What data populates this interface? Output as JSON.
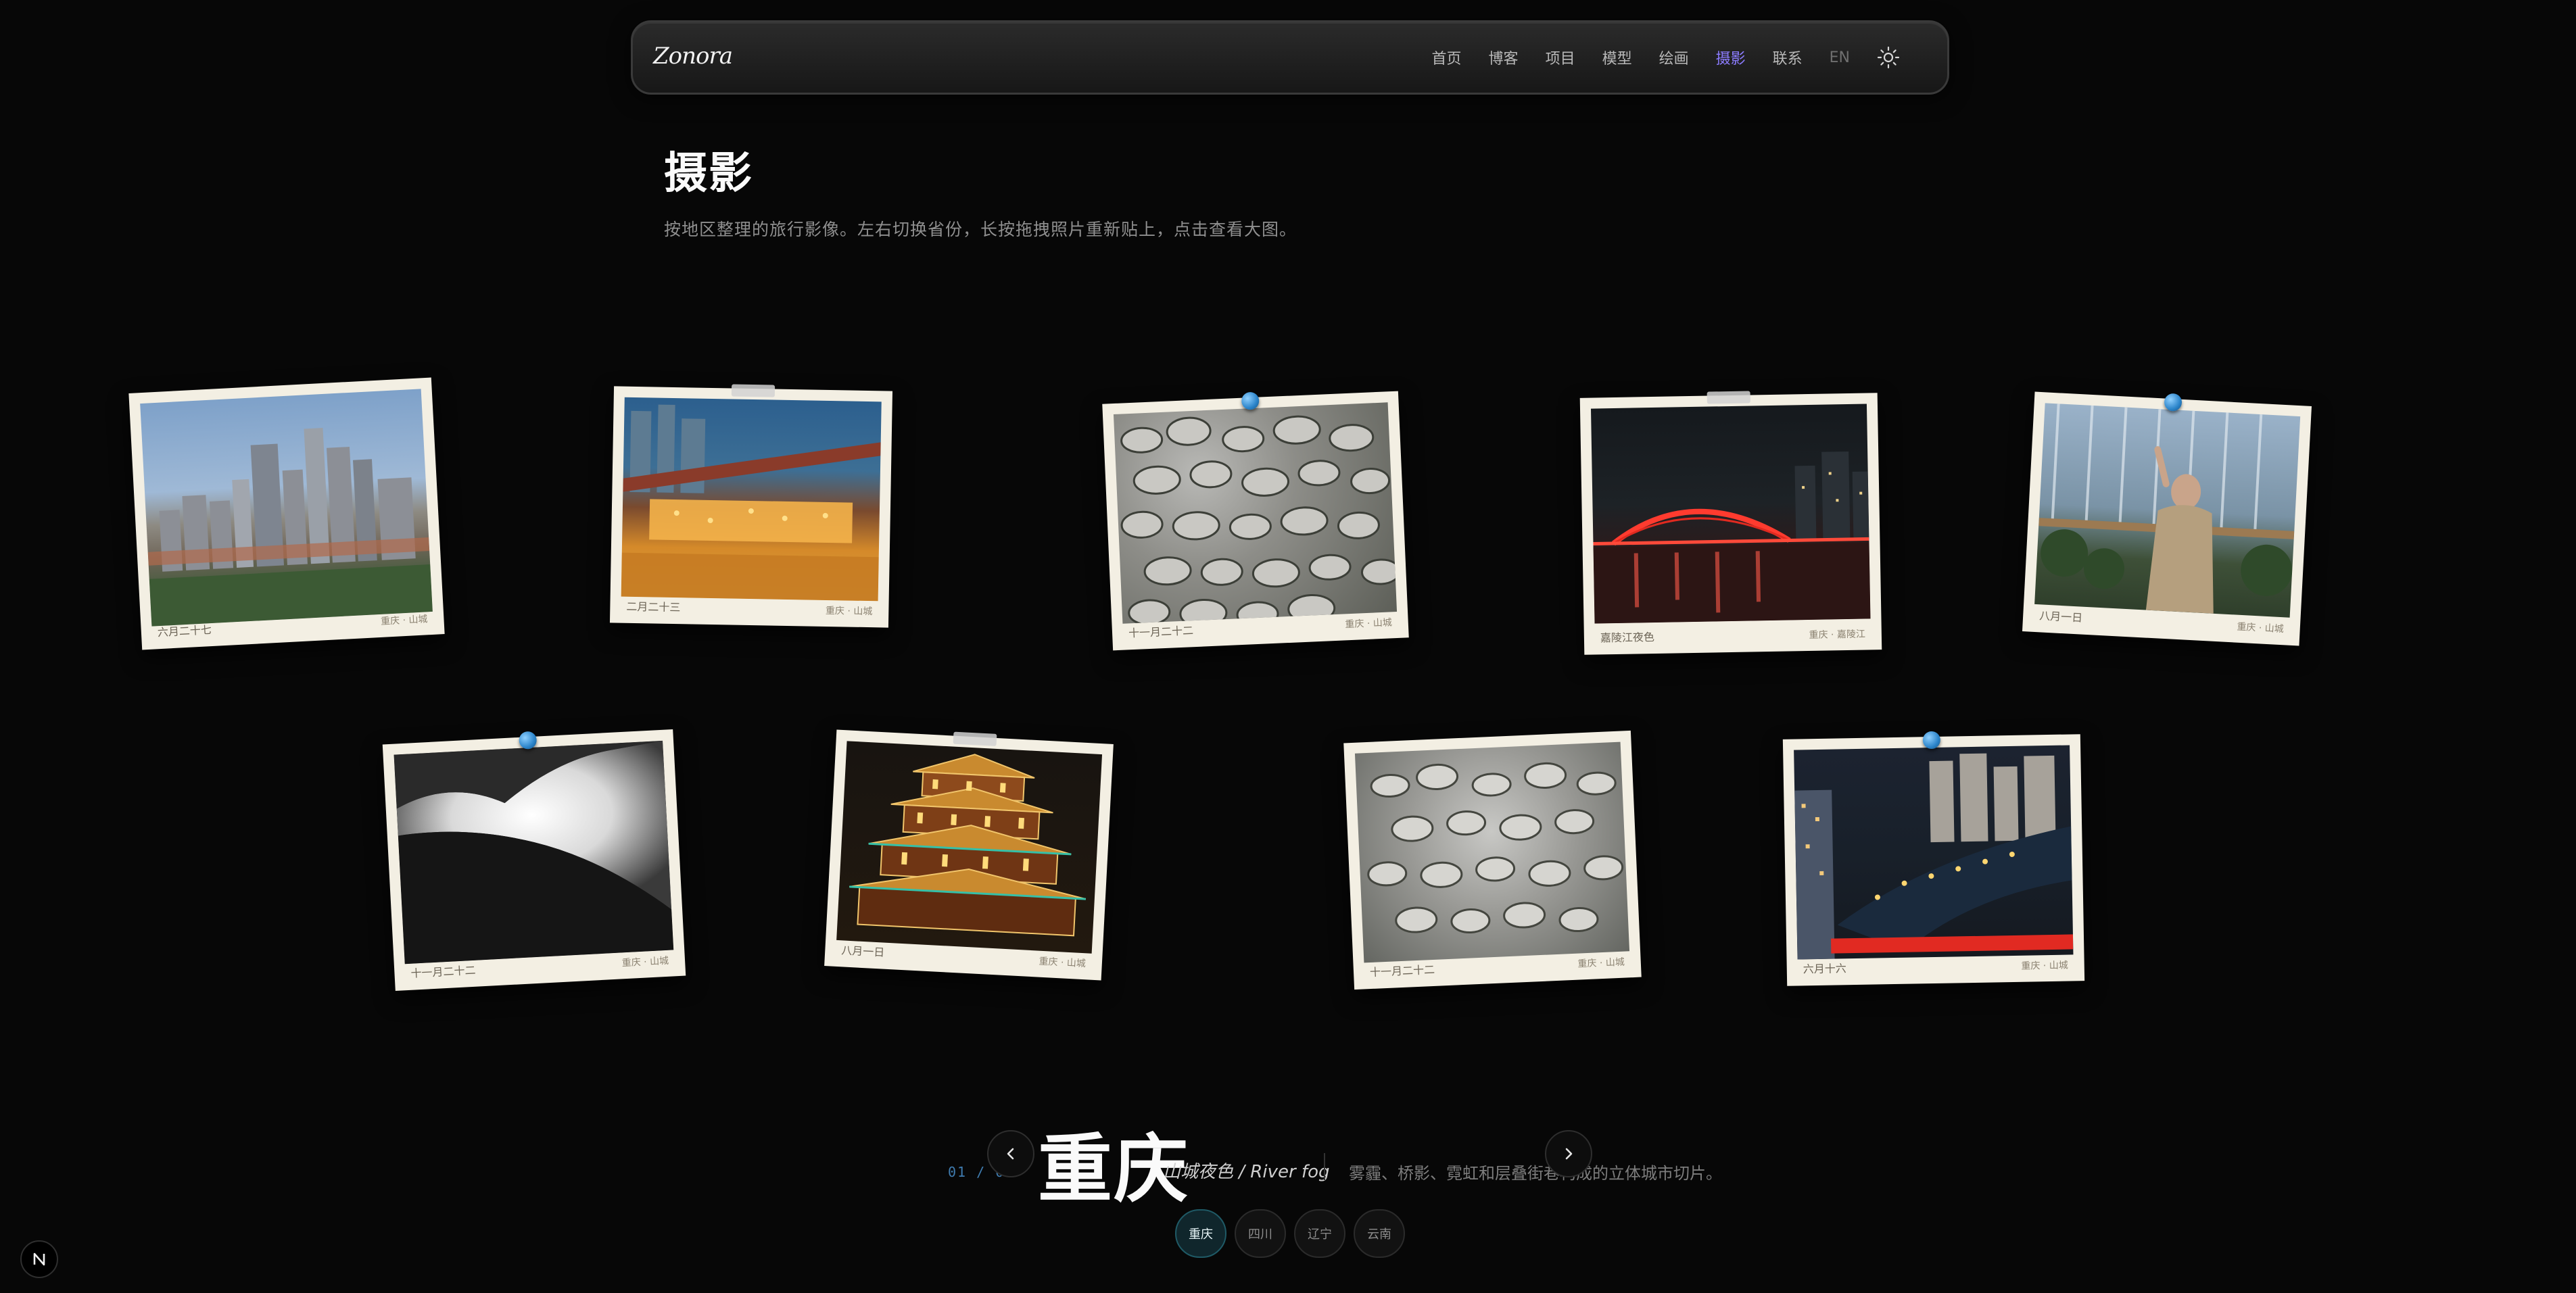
{
  "nav": {
    "logo": "Zonora",
    "items": [
      {
        "label": "首页"
      },
      {
        "label": "博客"
      },
      {
        "label": "项目"
      },
      {
        "label": "模型"
      },
      {
        "label": "绘画"
      },
      {
        "label": "摄影"
      },
      {
        "label": "联系"
      },
      {
        "label": "EN"
      }
    ],
    "active_index": 5,
    "theme_icon": "sun-icon",
    "accent_color": "#8c7cff"
  },
  "page": {
    "title": "摄影",
    "subtitle": "按地区整理的旅行影像。左右切换省份，长按拖拽照片重新贴上，点击查看大图。"
  },
  "photos": [
    {
      "caption": "六月二十七",
      "location": "重庆 · 山城",
      "subject": "city-skyline"
    },
    {
      "caption": "二月二十三",
      "location": "重庆 · 山城",
      "subject": "bridge-night-lights"
    },
    {
      "caption": "十一月二十二",
      "location": "重庆 · 山城",
      "subject": "cobblestones"
    },
    {
      "caption": "嘉陵江夜色",
      "location": "重庆 · 嘉陵江",
      "subject": "red-bridge-night"
    },
    {
      "caption": "八月一日",
      "location": "重庆 · 山城",
      "subject": "person-balcony"
    },
    {
      "caption": "十一月二十二",
      "location": "重庆 · 山城",
      "subject": "fog-valley"
    },
    {
      "caption": "八月一日",
      "location": "重庆 · 山城",
      "subject": "pagoda-night"
    },
    {
      "caption": "十一月二十二",
      "location": "重庆 · 山城",
      "subject": "stone-closeup"
    },
    {
      "caption": "六月十六",
      "location": "重庆 · 山城",
      "subject": "river-city-night"
    }
  ],
  "region": {
    "counter": "01 / 04",
    "name": "重庆",
    "tagline": "山城夜色 / River fog",
    "description": "雾霾、桥影、霓虹和层叠街巷构成的立体城市切片。",
    "prev_icon": "chevron-left-icon",
    "next_icon": "chevron-right-icon"
  },
  "provinces": [
    {
      "label": "重庆"
    },
    {
      "label": "四川"
    },
    {
      "label": "辽宁"
    },
    {
      "label": "云南"
    }
  ],
  "active_province": 0,
  "badge_icon": "n-logo-icon"
}
